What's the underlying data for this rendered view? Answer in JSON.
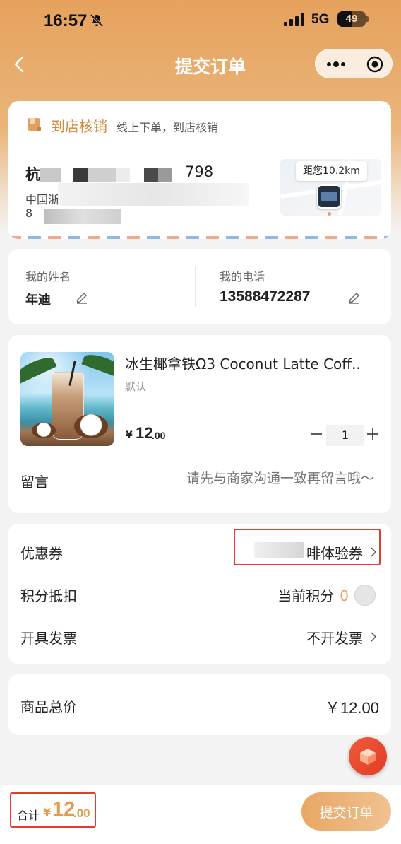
{
  "status_bar": {
    "time": "16:57",
    "network": "5G",
    "battery": "49"
  },
  "nav": {
    "title": "提交订单"
  },
  "store": {
    "tag": "到店核销",
    "tag_desc": "线上下单，到店核销",
    "name_prefix": "杭",
    "phone_tail": "798",
    "address_line1": "中国浙",
    "address_line2": "8",
    "distance": "距您10.2km"
  },
  "contact": {
    "name_label": "我的姓名",
    "name_value": "年迪",
    "phone_label": "我的电话",
    "phone_value": "13588472287"
  },
  "product": {
    "title": "冰生椰拿铁Ω3 Coconut Latte Coff..",
    "spec": "默认",
    "price_symbol": "¥",
    "price_int": "12",
    "price_dec": ".00",
    "quantity": "1",
    "message_label": "留言",
    "message_placeholder": "请先与商家沟通一致再留言哦～"
  },
  "options": {
    "coupon_label": "优惠券",
    "coupon_value": "啡体验券",
    "points_label": "积分抵扣",
    "points_text": "当前积分",
    "points_value": "0",
    "invoice_label": "开具发票",
    "invoice_value": "不开发票"
  },
  "summary": {
    "total_label": "商品总价",
    "total_value": "￥12.00"
  },
  "footer": {
    "sum_label": "合计",
    "sum_symbol": "¥",
    "sum_int": "12",
    "sum_dec": ".00",
    "submit_label": "提交订单"
  },
  "colors": {
    "accent": "#e6a25d",
    "highlight_border": "#e53b35",
    "float_button": "#e84a30"
  },
  "icons": [
    "bell-off-icon",
    "back-icon",
    "more-icon",
    "target-icon",
    "store-tag-icon",
    "edit-icon",
    "minus-icon",
    "plus-icon",
    "chevron-right-icon",
    "cube-icon"
  ]
}
